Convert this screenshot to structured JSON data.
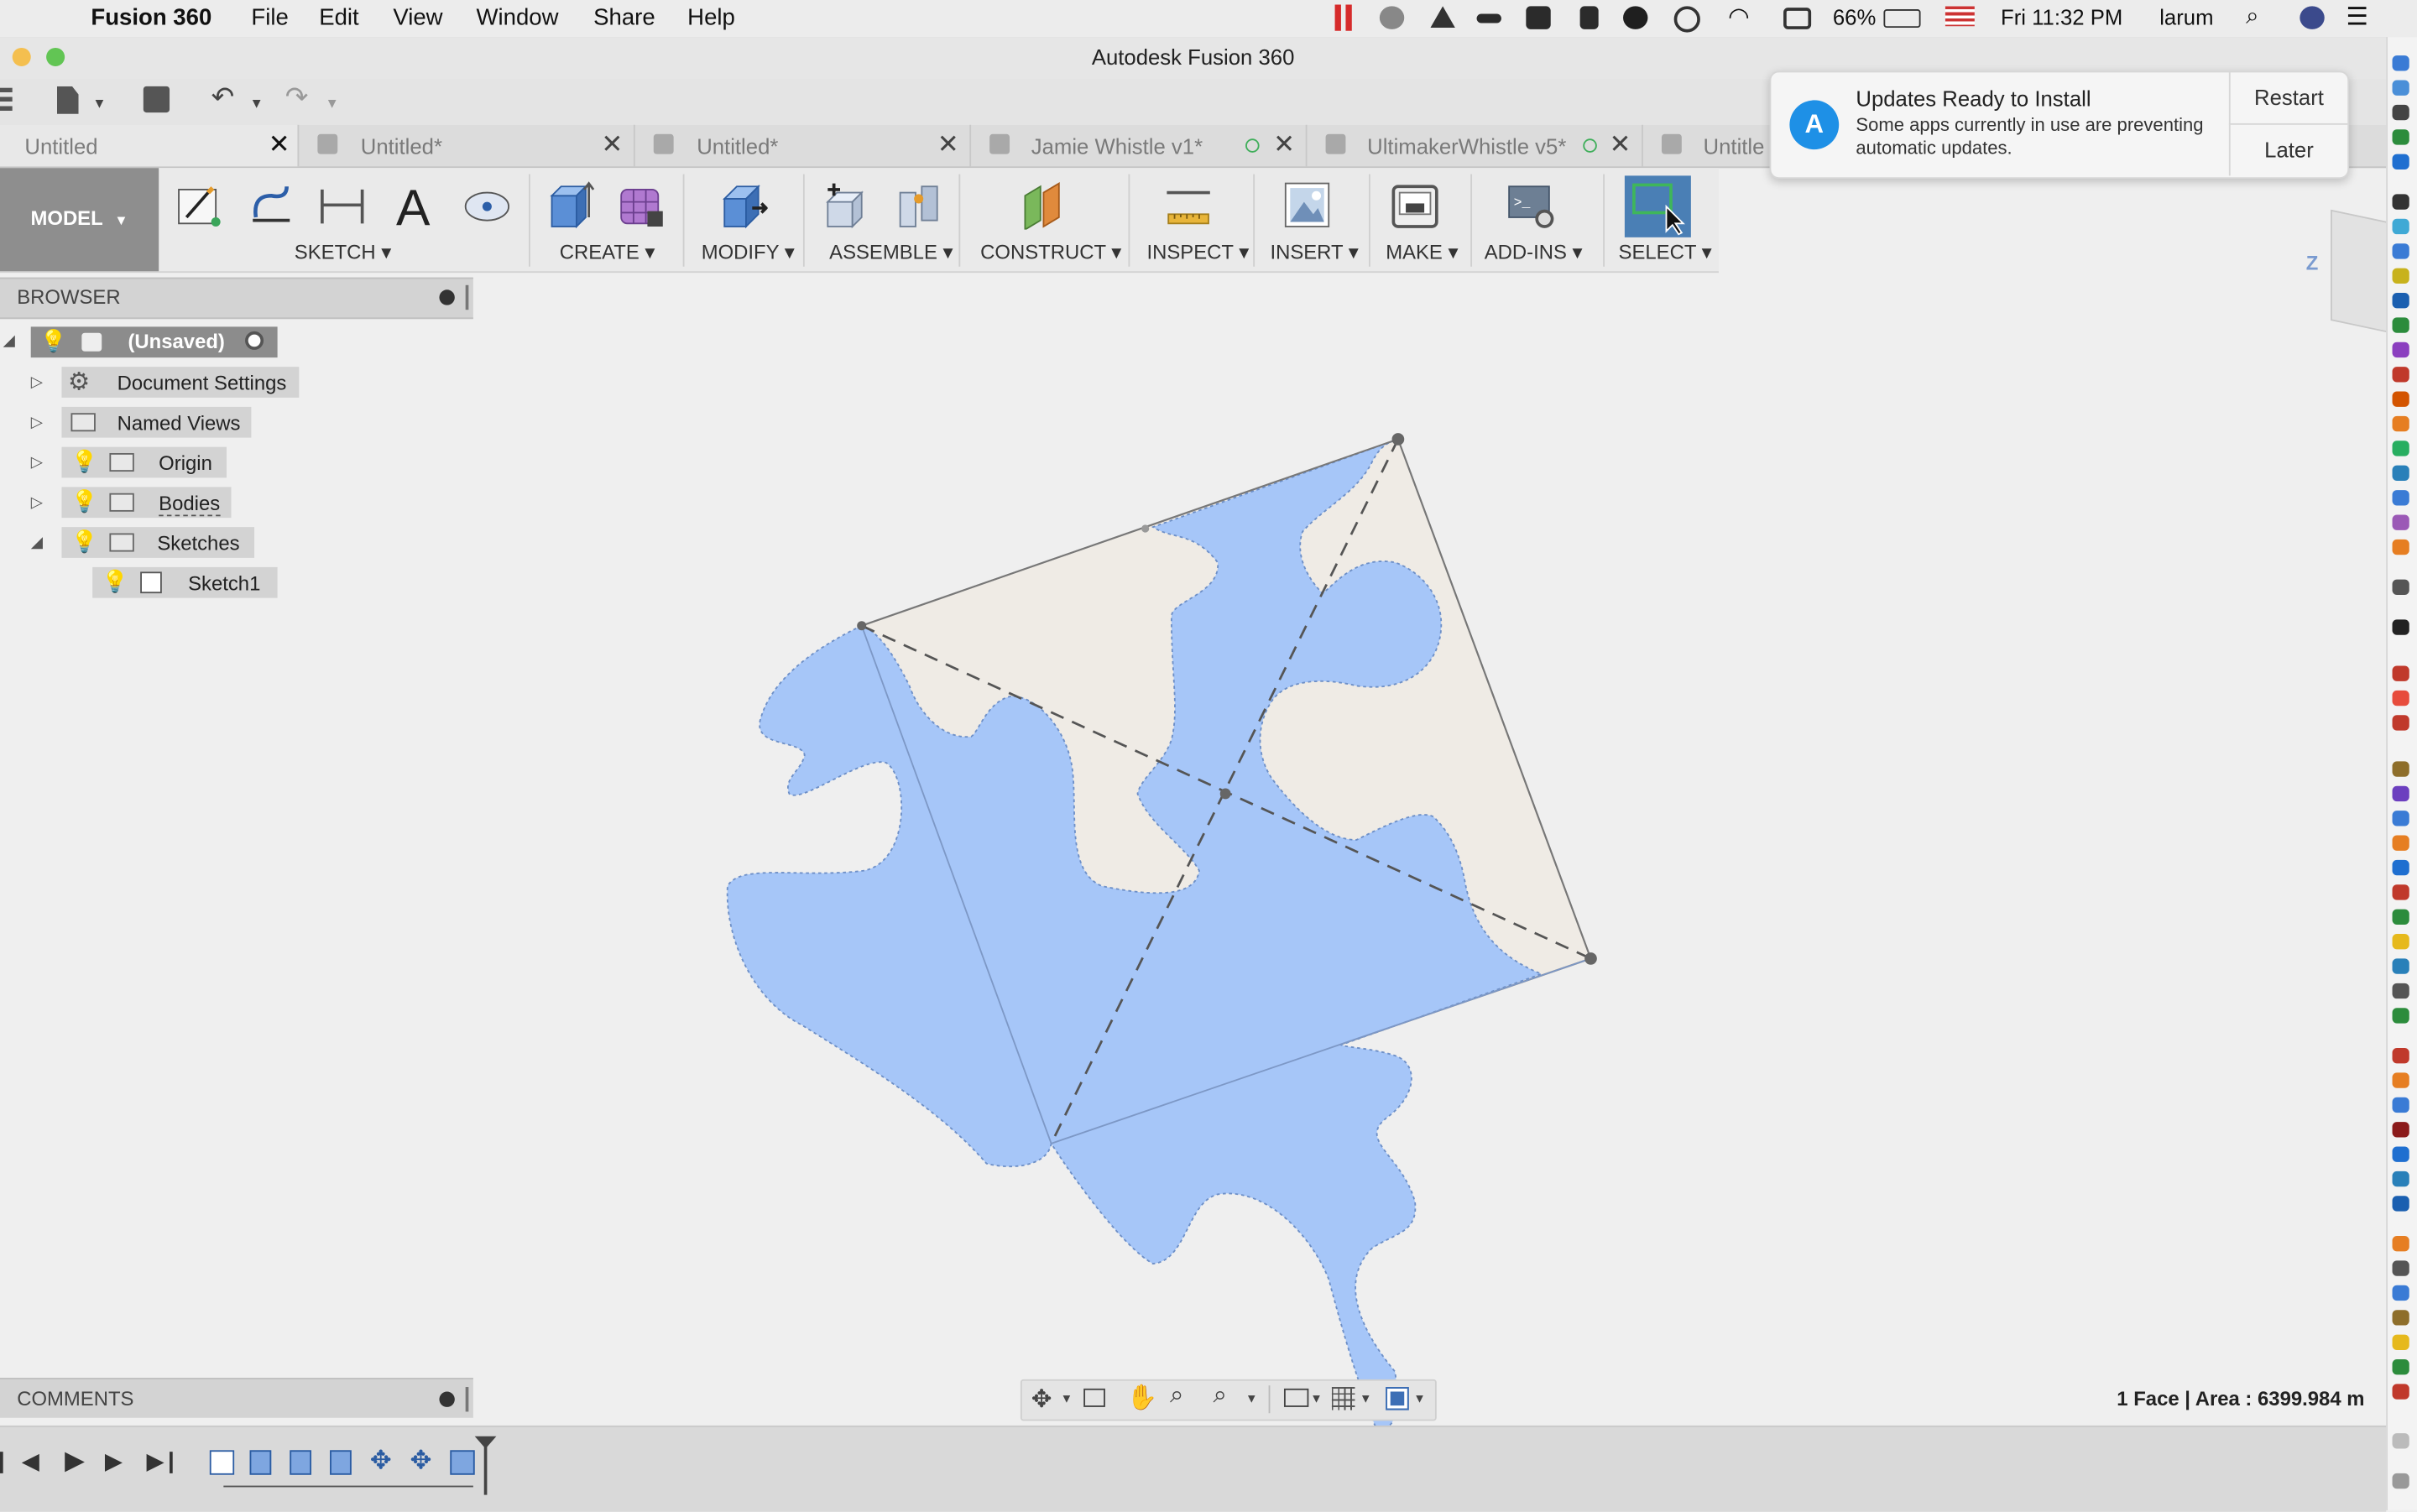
{
  "menubar": {
    "app_name": "Fusion 360",
    "menus": [
      "File",
      "Edit",
      "View",
      "Window",
      "Share",
      "Help"
    ],
    "battery": "66%",
    "clock": "Fri 11:32 PM",
    "user": "larum"
  },
  "window": {
    "title": "Autodesk Fusion 360"
  },
  "tabs": [
    {
      "label": "Untitled"
    },
    {
      "label": "Untitled*"
    },
    {
      "label": "Untitled*"
    },
    {
      "label": "Jamie Whistle v1*"
    },
    {
      "label": "UltimakerWhistle v5*"
    },
    {
      "label": "Untitle"
    }
  ],
  "toolbar": {
    "workspace": "MODEL",
    "groups": [
      "SKETCH",
      "CREATE",
      "MODIFY",
      "ASSEMBLE",
      "CONSTRUCT",
      "INSPECT",
      "INSERT",
      "MAKE",
      "ADD-INS",
      "SELECT"
    ]
  },
  "browser": {
    "header": "BROWSER",
    "root": "(Unsaved)",
    "nodes": [
      "Document Settings",
      "Named Views",
      "Origin",
      "Bodies",
      "Sketches",
      "Sketch1"
    ]
  },
  "comments": {
    "header": "COMMENTS"
  },
  "status": {
    "selection": "1 Face | Area : 6399.984 m"
  },
  "notification": {
    "title": "Updates Ready to Install",
    "body": "Some apps currently in use are preventing automatic updates.",
    "restart": "Restart",
    "later": "Later"
  },
  "viewcube": {
    "axis": "Z"
  },
  "colors": {
    "face": "#a6c6f8",
    "model_bg": "#8e8e8e",
    "select_bg": "#4a7fb5"
  }
}
